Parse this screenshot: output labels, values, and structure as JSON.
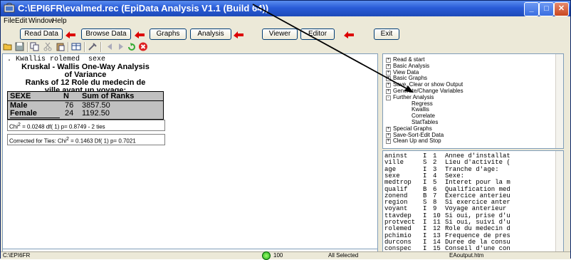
{
  "window": {
    "title": "C:\\EPI6FR\\evalmed.rec (EpiData Analysis V1.1 (Build 64))",
    "controls": [
      "_",
      "□",
      "✕"
    ]
  },
  "menu": [
    "File",
    "Edit",
    "Window",
    "Help"
  ],
  "commands": {
    "read_data": "Read Data",
    "browse_data": "Browse Data",
    "graphs": "Graphs",
    "analysis": "Analysis",
    "viewer": "Viewer",
    "editor": "Editor",
    "exit": "Exit"
  },
  "output": {
    "command": ". Kwallis rolemed  sexe",
    "title_lines": [
      "Kruskal - Wallis One-Way Analysis",
      "of Variance",
      "Ranks of 12 Role du medecin de",
      "ville avant un voyage:"
    ],
    "table": {
      "headers": [
        "SEXE",
        "N",
        "Sum of Ranks"
      ],
      "rows": [
        [
          "Male",
          "76",
          "3857.50"
        ],
        [
          "Female",
          "24",
          "1192.50"
        ]
      ]
    },
    "chi1": {
      "pre": "Chi",
      "sup": "2",
      "post": " = 0.0248 df( 1) p= 0.8749 - 2 ties"
    },
    "chi2": {
      "pre": "Corrected for Ties: Chi",
      "sup": "2",
      "post": " = 0.1463 Df( 1) p= 0.7021"
    }
  },
  "tree": [
    {
      "sign": "+",
      "label": "Read & start"
    },
    {
      "sign": "+",
      "label": "Basic Analysis"
    },
    {
      "sign": "+",
      "label": "View Data"
    },
    {
      "sign": "+",
      "label": "Basic Graphs"
    },
    {
      "sign": "+",
      "label": "Save, Clear or show Output"
    },
    {
      "sign": "+",
      "label": "Generate/Change Variables"
    },
    {
      "sign": "-",
      "label": "Further Analysis"
    },
    {
      "sign": "",
      "label": "Regress"
    },
    {
      "sign": "",
      "label": "Kwallis"
    },
    {
      "sign": "",
      "label": "Correlate"
    },
    {
      "sign": "",
      "label": "StatTables"
    },
    {
      "sign": "+",
      "label": "Special Graphs"
    },
    {
      "sign": "+",
      "label": "Save-Sort-Edit Data"
    },
    {
      "sign": "+",
      "label": "Clean Up and Stop"
    }
  ],
  "variables": [
    [
      "aninst",
      "I",
      "1",
      "Annee d'installat"
    ],
    [
      "ville",
      "S",
      "2",
      "Lieu d'activite ("
    ],
    [
      "age",
      "I",
      "3",
      "Tranche d'age:"
    ],
    [
      "sexe",
      "I",
      "4",
      "Sexe:"
    ],
    [
      "medtrop",
      "I",
      "5",
      "Interet pour la m"
    ],
    [
      "qualif",
      "B",
      "6",
      "Qualification med"
    ],
    [
      "zonend",
      "B",
      "7",
      "Exercice anterieu"
    ],
    [
      "region",
      "S",
      "8",
      "Si exercice anter"
    ],
    [
      "voyant",
      "I",
      "9",
      "Voyage anterieur"
    ],
    [
      "ttavdep",
      "I",
      "10",
      "Si oui, prise d'u"
    ],
    [
      "protvect",
      "I",
      "11",
      "Si oui, suivi d'u"
    ],
    [
      "rolemed",
      "I",
      "12",
      "Role du medecin d"
    ],
    [
      "pchimio",
      "I",
      "13",
      "Frequence de pres"
    ],
    [
      "durcons",
      "I",
      "14",
      "Duree de la consu"
    ],
    [
      "conspec",
      "I",
      "15",
      "Conseil d'une con"
    ]
  ],
  "status": {
    "path": "C:\\EPI6FR",
    "count": "100",
    "selection": "All Selected",
    "output_file": "EAoutput.htm"
  }
}
